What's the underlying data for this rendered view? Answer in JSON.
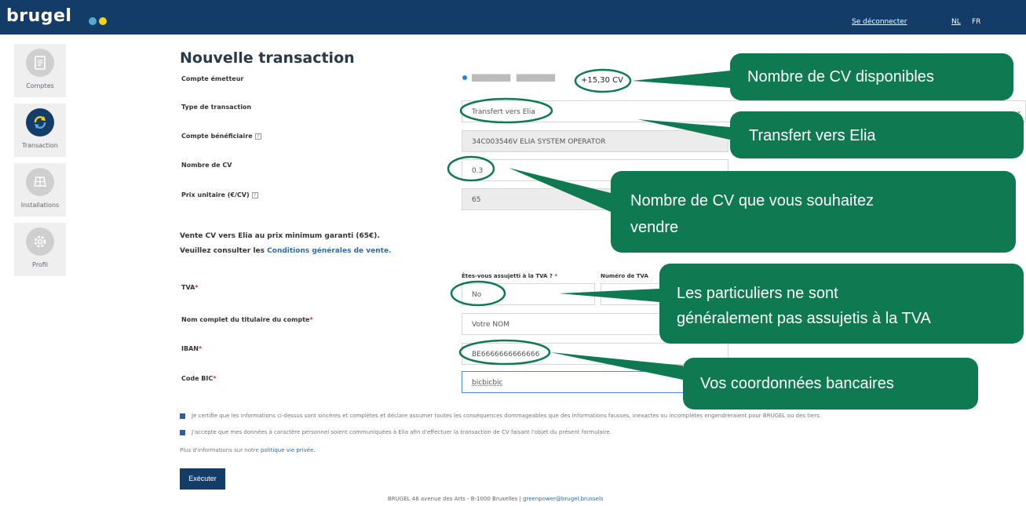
{
  "header": {
    "logo": "brugel",
    "logout": "Se déconnecter",
    "lang_nl": "NL",
    "lang_fr": "FR"
  },
  "sidebar": {
    "items": [
      {
        "label": "Comptes",
        "icon": "document-icon",
        "active": false
      },
      {
        "label": "Transaction",
        "icon": "refresh-icon",
        "active": true
      },
      {
        "label": "Installations",
        "icon": "solar-panel-icon",
        "active": false
      },
      {
        "label": "Profil",
        "icon": "gear-icon",
        "active": false
      }
    ]
  },
  "form": {
    "title": "Nouvelle transaction",
    "compte_emetteur_label": "Compte émetteur",
    "cv_available": "+15,30 CV",
    "type_label": "Type de transaction",
    "type_value": "Transfert vers Elia",
    "beneficiaire_label": "Compte bénéficiaire",
    "beneficiaire_value": "34C003546V ELIA SYSTEM OPERATOR",
    "nombre_label": "Nombre de CV",
    "nombre_value": "0.3",
    "prix_label": "Prix unitaire (€/CV)",
    "prix_value": "65",
    "help_mark": "?",
    "info_line1": "Vente CV vers Elia au prix minimum garanti (65€).",
    "info_line2_prefix": "Veuillez consulter les ",
    "info_line2_link": "Conditions générales de vente.",
    "tva_label": "TVA",
    "tva_question": "Êtes-vous assujetti à la TVA ?",
    "tva_number_label": "Numéro de TVA",
    "tva_value": "No",
    "titulaire_label": "Nom complet du titulaire du compte",
    "titulaire_value": "Votre NOM",
    "iban_label": "IBAN",
    "iban_value": "BE6666666666666",
    "bic_label": "Code BIC",
    "bic_value": "bicbicbic",
    "required_mark": "*",
    "check1": "Je certifie que les informations ci-dessus sont sincères et complètes et déclare assumer toutes les conséquences dommageables que des informations fausses, inexactes ou incomplètes engendreraient pour BRUGEL ou des tiers.",
    "check2": "J'accepte que mes données à caractère personnel soient communiquées à Elia afin d'effectuer la transaction de CV faisant l'objet du présent formulaire.",
    "privacy_prefix": "Plus d'informations sur notre ",
    "privacy_link": "politique vie privée.",
    "submit": "Exécuter"
  },
  "footer": {
    "text": "BRUGEL 46 avenue des Arts - B-1000 Bruxelles | ",
    "email": "greenpower@brugel.brussels"
  },
  "callouts": {
    "c1": "Nombre de CV disponibles",
    "c2": "Transfert vers Elia",
    "c3_line1": "Nombre de CV que vous souhaitez",
    "c3_line2": "vendre",
    "c4_line1": "Les particuliers ne sont",
    "c4_line2": "généralement pas assujetis à la TVA",
    "c5": "Vos coordonnées bancaires",
    "color": "#0f7a52"
  },
  "colors": {
    "navy": "#143c68",
    "callout_green": "#0f7a52",
    "link_blue": "#2a6db0"
  }
}
